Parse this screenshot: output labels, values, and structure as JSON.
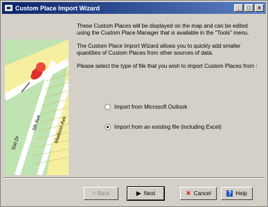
{
  "window": {
    "title": "Custom Place Import Wizard",
    "controls": {
      "minimize": "_",
      "maximize": "□",
      "close": "×"
    }
  },
  "illustration": {
    "streets": [
      "5th Ave",
      "Madison Ave",
      "Sixt Dr"
    ]
  },
  "text": {
    "para1": "These Custom Places will be displayed on the map and can be edited using the Custom Place Manager that is available in the \"Tools\" menu.",
    "para2": "The Custom Place Import Wizard allows you to quickly add smaller quantities of Custom Places from other sources of data.",
    "para3": "Please select the type of file that you wish to import Custom Places from :"
  },
  "options": [
    {
      "label": "Import from Microsoft Outlook",
      "checked": false
    },
    {
      "label": "Import from an existing file (including Excel)",
      "checked": true
    }
  ],
  "buttons": {
    "back": "< Back",
    "next": "Next",
    "cancel": "Cancel",
    "help": "Help"
  },
  "icons": {
    "next": "play-icon",
    "cancel": "red-x-icon",
    "help": "question-icon"
  }
}
